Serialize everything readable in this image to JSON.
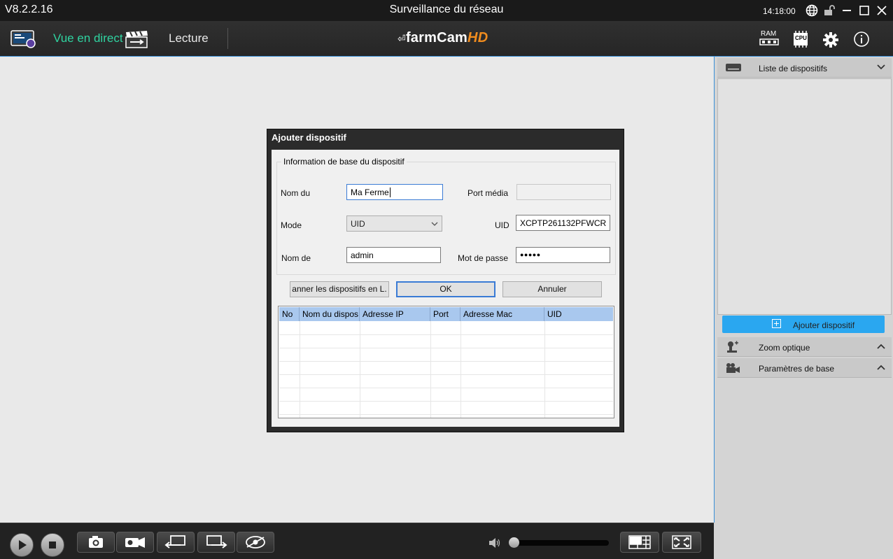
{
  "titlebar": {
    "version": "V8.2.2.16",
    "title": "Surveillance du réseau",
    "time": "14:18:00",
    "icons": [
      "globe-icon",
      "lock-icon",
      "minimize-icon",
      "maximize-icon",
      "close-icon"
    ]
  },
  "toolbar": {
    "live_label": "Vue en direct",
    "playback_label": "Lecture",
    "logo_main": "farmCam",
    "logo_suffix": "HD",
    "ram_label": "RAM",
    "cpu_label": "CPU"
  },
  "dialog": {
    "title": "Ajouter dispositif",
    "group_title": "Information de base du dispositif",
    "name_label": "Nom du",
    "name_value": "Ma Ferme",
    "media_port_label": "Port média",
    "media_port_value": "",
    "mode_label": "Mode",
    "mode_value": "UID",
    "uid_label": "UID",
    "uid_value": "XCPTP261132PFWCR",
    "user_label": "Nom de",
    "user_value": "admin",
    "password_label": "Mot de passe",
    "password_value": "●●●●●",
    "scan_button": "anner les dispositifs en L.",
    "ok_button": "OK",
    "cancel_button": "Annuler",
    "table_headers": [
      "No",
      "Nom du dispos",
      "Adresse IP",
      "Port",
      "Adresse Mac",
      "UID"
    ]
  },
  "rightpanel": {
    "device_list_label": "Liste de dispositifs",
    "add_device_label": "Ajouter dispositif",
    "optical_zoom_label": "Zoom optique",
    "basic_params_label": "Paramètres de base"
  },
  "colors": {
    "accent": "#3a8fd8",
    "live_green": "#2fd3a0",
    "logo_orange": "#f08c1e",
    "add_button_blue": "#2aa7f0",
    "table_header": "#a9c8ee"
  }
}
